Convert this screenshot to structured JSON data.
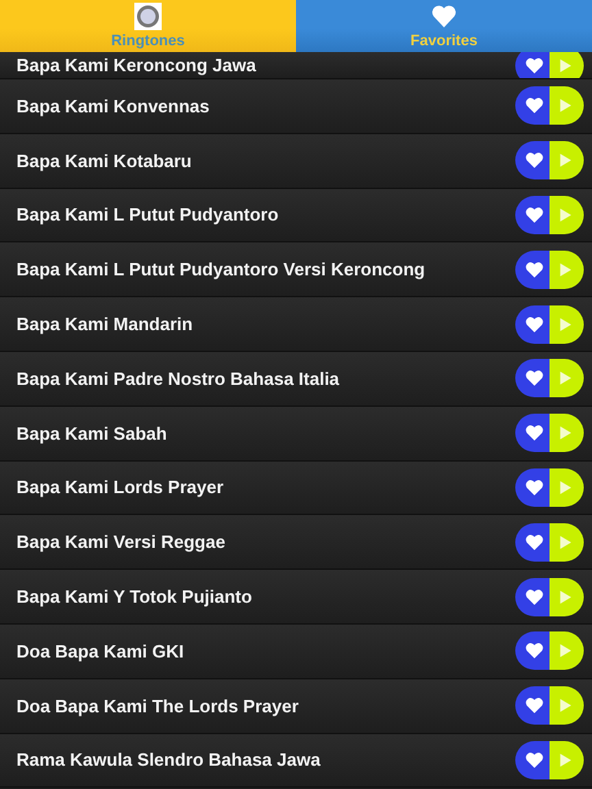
{
  "tabs": [
    {
      "label": "Ringtones",
      "kind": "logo",
      "selected": true
    },
    {
      "label": "Favorites",
      "kind": "heart",
      "selected": false
    }
  ],
  "partial_row": {
    "title": "Bapa Kami Keroncong Jawa"
  },
  "rows": [
    {
      "title": "Bapa Kami Konvennas"
    },
    {
      "title": "Bapa Kami Kotabaru"
    },
    {
      "title": "Bapa Kami L Putut Pudyantoro"
    },
    {
      "title": "Bapa Kami L Putut Pudyantoro Versi Keroncong"
    },
    {
      "title": "Bapa Kami Mandarin"
    },
    {
      "title": "Bapa Kami Padre Nostro Bahasa Italia"
    },
    {
      "title": "Bapa Kami Sabah"
    },
    {
      "title": "Bapa Kami Lords Prayer"
    },
    {
      "title": "Bapa Kami Versi Reggae"
    },
    {
      "title": "Bapa Kami Y Totok Pujianto"
    },
    {
      "title": "Doa Bapa Kami GKI"
    },
    {
      "title": "Doa Bapa Kami The Lords Prayer"
    },
    {
      "title": "Rama Kawula Slendro Bahasa Jawa"
    }
  ]
}
